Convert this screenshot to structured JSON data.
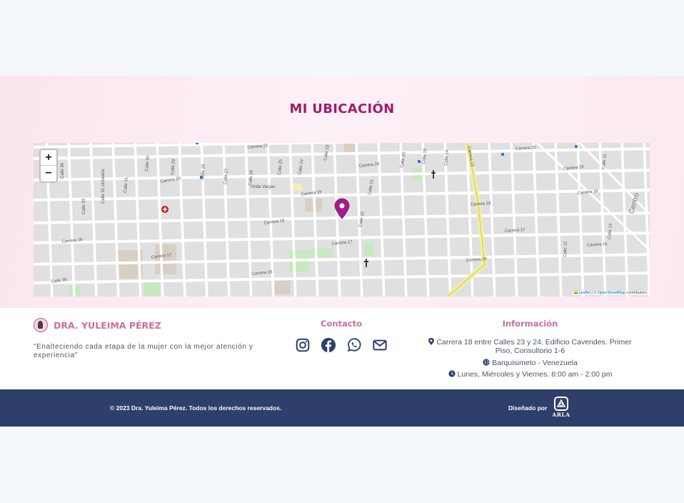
{
  "location": {
    "title": "MI UBICACIÓN",
    "map": {
      "zoom_in": "+",
      "zoom_out": "−",
      "street_labels": [
        "Carrera 21",
        "Carrera 20",
        "Carrera 20",
        "Carrera 20",
        "Carrera 19",
        "Carrera 19",
        "Carrera 18",
        "Carrera 18",
        "Carrera 18",
        "Carrera 18",
        "Carrera 17",
        "Carrera 17",
        "Carrera 17",
        "Carrera 16",
        "Carrera 16",
        "Carrera 16",
        "Calle 35",
        "Calle 34",
        "Calle 33",
        "Calle 32 Urdaneta",
        "Calle 31",
        "Calle 30",
        "Calle 29",
        "Calle 28",
        "Calle 27",
        "Calle 26",
        "Calle 25",
        "Calle 24",
        "Calle 23",
        "Calle 22",
        "Calle 21",
        "Calle 20",
        "Calle 19",
        "Calle 14",
        "Calle 12",
        "Calle 11",
        "Calle 13",
        "Centro",
        "rnida Vargas",
        "Carrera 15",
        "Calle 18"
      ],
      "attribution_leaflet": "Leaflet",
      "attribution_sep": " | © ",
      "attribution_osm": "OpenStreetMap",
      "attribution_tail": " contributors",
      "marker_color": "#a01d8c"
    }
  },
  "footer": {
    "brand_name": "DRA. YULEIMA PÉREZ",
    "quote": "\"Enalteciendo cada etapa de la mujer con la mejor atención y experiencia\"",
    "contact_title": "Contacto",
    "social_icons": [
      "instagram-icon",
      "facebook-icon",
      "whatsapp-icon",
      "envelope-icon"
    ],
    "info_title": "Información",
    "address": "Carrera 18 entre Calles 23 y 24. Edificio Cavendes. Primer Piso, Consultorio 1-6",
    "city": "Barquisimeto - Venezuela",
    "hours": "Lunes, Miércoles y Viernes. 8:00 am - 2:00 pm",
    "accent_color": "#c86f9f"
  },
  "bottom_bar": {
    "copyright": "© 2023 Dra. Yuleima Pérez. Todos los derechos reservados.",
    "designed_by": "Diseñado por",
    "designer_logo_text": "ARLA",
    "background": "#2e3f6b"
  }
}
